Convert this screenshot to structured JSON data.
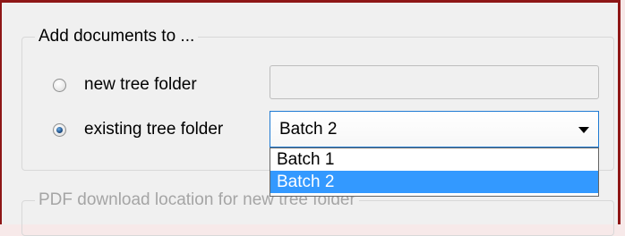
{
  "add_group": {
    "title": "Add documents to ...",
    "options": [
      {
        "label": "new tree folder",
        "checked": false
      },
      {
        "label": "existing tree folder",
        "checked": true
      }
    ]
  },
  "combo": {
    "value": "Batch 2",
    "options": [
      "Batch 1",
      "Batch 2"
    ],
    "selected_option": "Batch 2"
  },
  "new_folder_name": {
    "value": ""
  },
  "pdf_group": {
    "title": "PDF download location for new tree folder"
  },
  "colors": {
    "accent_border": "#8e1616",
    "selection": "#3399ff",
    "focus_border": "#1e7ad3"
  }
}
